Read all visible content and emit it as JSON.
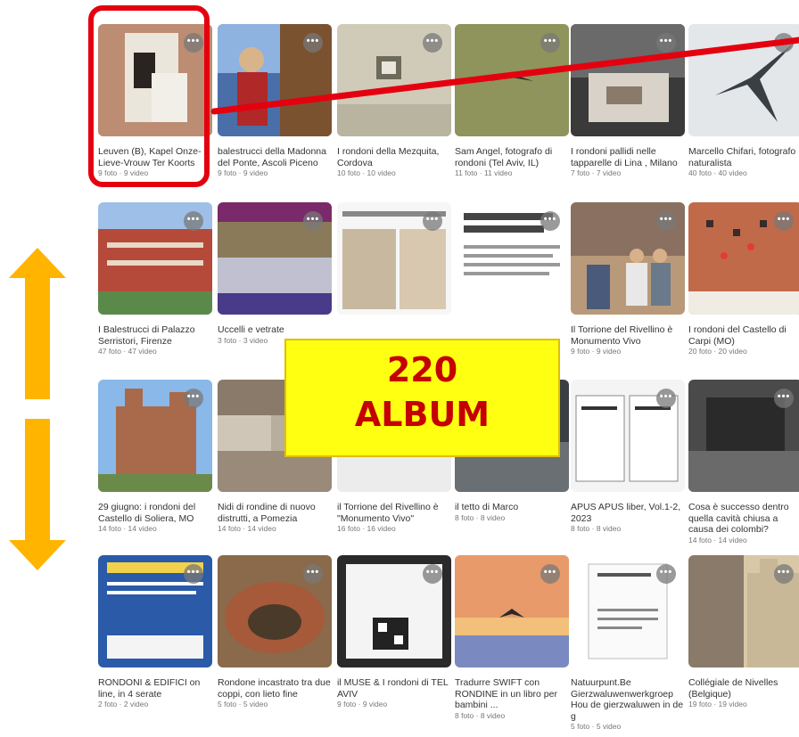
{
  "albums": [
    {
      "title": "Leuven (B), Kapel Onze-Lieve-Vrouw Ter Koorts",
      "count": "9 foto · 9 video",
      "thumb": "brick-wall-icon"
    },
    {
      "title": "balestrucci della Madonna del Ponte, Ascoli Piceno",
      "count": "9 foto · 9 video",
      "thumb": "worker-photo"
    },
    {
      "title": "I rondoni della Mezquita, Cordova",
      "count": "10 foto · 10 video",
      "thumb": "stone-wall-photo"
    },
    {
      "title": "Sam Angel, fotografo di rondoni (Tel Aviv, IL)",
      "count": "11 foto · 11 video",
      "thumb": "swift-flight-photo"
    },
    {
      "title": "I rondoni pallidi nelle tapparelle di Lina , Milano",
      "count": "7 foto · 7 video",
      "thumb": "shutter-photo"
    },
    {
      "title": "Marcello Chifari, fotografo naturalista",
      "count": "40 foto · 40 video",
      "thumb": "swift-sky-photo"
    },
    {
      "title": "I Balestrucci di Palazzo Serristori, Firenze",
      "count": "47 foto · 47 video",
      "thumb": "palazzo-photo"
    },
    {
      "title": "Uccelli e vetrate",
      "count": "3 foto · 3 video",
      "thumb": "poster-photo"
    },
    {
      "title": "",
      "count": "",
      "thumb": "document-photo"
    },
    {
      "title": "",
      "count": "",
      "thumb": "article-photo"
    },
    {
      "title": "Il Torrione del Rivellino è Monumento Vivo",
      "count": "9 foto · 9 video",
      "thumb": "people-photo"
    },
    {
      "title": "I rondoni del Castello di Carpi (MO)",
      "count": "20 foto · 20 video",
      "thumb": "castle-wall-photo"
    },
    {
      "title": "29 giugno: i rondoni del Castello di Soliera, MO",
      "count": "14 foto · 14 video",
      "thumb": "castle-photo"
    },
    {
      "title": "Nidi di rondine di nuovo distrutti, a Pomezia",
      "count": "14 foto · 14 video",
      "thumb": "nest-photo"
    },
    {
      "title": "il Torrione del Rivellino è \"Monumento Vivo\"",
      "count": "16 foto · 16 video",
      "thumb": "newspaper-photo"
    },
    {
      "title": "il tetto di Marco",
      "count": "8 foto · 8 video",
      "thumb": "roof-photo"
    },
    {
      "title": "APUS APUS liber, Vol.1-2, 2023",
      "count": "8 foto · 8 video",
      "thumb": "book-photo"
    },
    {
      "title": "Cosa è successo dentro quella cavità chiusa a causa dei colombi?",
      "count": "14 foto · 14 video",
      "thumb": "cavity-photo"
    },
    {
      "title": "RONDONI & EDIFICI on line, in 4 serate",
      "count": "2 foto · 2 video",
      "thumb": "flyer-photo"
    },
    {
      "title": "Rondone incastrato tra due coppi, con lieto fine",
      "count": "5 foto · 5 video",
      "thumb": "tiles-photo"
    },
    {
      "title": "il MUSE & I rondoni di TEL AVIV",
      "count": "9 foto · 9 video",
      "thumb": "qr-photo"
    },
    {
      "title": "Tradurre SWIFT con RONDINE in un libro per bambini ...",
      "count": "8 foto · 8 video",
      "thumb": "book-cover-photo"
    },
    {
      "title": "Natuurpunt.Be Gierzwaluwenwerkgroep Hou de gierzwaluwen in de g",
      "count": "5 foto · 5 video",
      "thumb": "letter-photo"
    },
    {
      "title": "Collégiale de Nivelles (Belgique)",
      "count": "19 foto · 19 video",
      "thumb": "church-photo"
    }
  ],
  "overlay": {
    "banner_number": "220",
    "banner_label": "ALBUM",
    "accent_red": "#e4000f",
    "arrow_color": "#ffb400",
    "banner_color": "#ffff12"
  },
  "ui": {
    "more_glyph": "•••"
  }
}
